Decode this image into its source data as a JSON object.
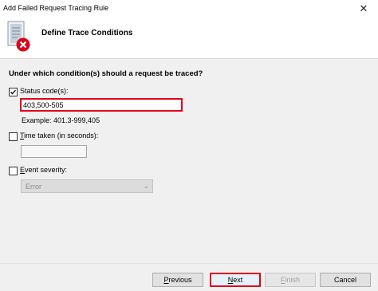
{
  "window": {
    "title": "Add Failed Request Tracing Rule",
    "close_glyph": "✕"
  },
  "header": {
    "title": "Define Trace Conditions",
    "icon": "trace-rule-error-icon",
    "error_color": "#d9001b"
  },
  "form": {
    "question": "Under which condition(s) should a request be traced?",
    "status_codes": {
      "label": "Status code(s):",
      "checked": true,
      "value": "403,500-505",
      "example": "Example: 401.3-999,405"
    },
    "time_taken": {
      "label_ul": "T",
      "label_rest": "ime taken (in seconds):",
      "checked": false,
      "value": ""
    },
    "event_severity": {
      "label_ul": "E",
      "label_rest": "vent severity:",
      "checked": false,
      "selected": "Error"
    }
  },
  "buttons": {
    "previous": {
      "ul": "P",
      "rest": "revious"
    },
    "next": {
      "ul": "N",
      "rest": "ext"
    },
    "finish": {
      "ul": "F",
      "rest": "inish"
    },
    "cancel": "Cancel"
  },
  "accent": "#e0001a"
}
